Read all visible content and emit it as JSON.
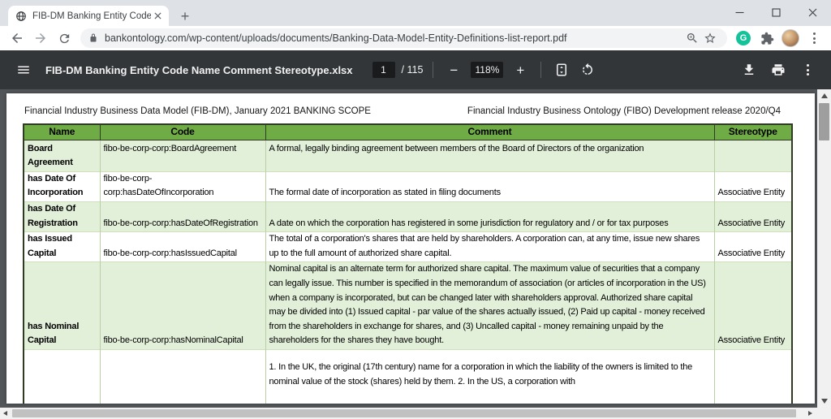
{
  "browser": {
    "tab_title": "FIB-DM Banking Entity Code Nam",
    "new_tab_glyph": "+",
    "url": "bankontology.com/wp-content/uploads/documents/Banking-Data-Model-Entity-Definitions-list-report.pdf",
    "grammarly_letter": "G"
  },
  "pdf_toolbar": {
    "filename": "FIB-DM Banking Entity Code Name Comment Stereotype.xlsx",
    "page_current": "1",
    "page_total_label": "/ 115",
    "zoom_out_glyph": "−",
    "zoom_level": "118%",
    "zoom_in_glyph": "+"
  },
  "document": {
    "header_left": "Financial Industry Business Data Model (FIB-DM), January 2021 BANKING SCOPE",
    "header_right": "Financial Industry Business Ontology (FIBO) Development release 2020/Q4",
    "table": {
      "columns": [
        "Name",
        "Code",
        "Comment",
        "Stereotype"
      ],
      "rows": [
        {
          "name": "Board Agreement",
          "code": "fibo-be-corp-corp:BoardAgreement",
          "comment": "A formal, legally binding agreement between members of the Board of Directors of the organization",
          "stereotype": ""
        },
        {
          "name": "has Date Of Incorporation",
          "code": "fibo-be-corp-corp:hasDateOfIncorporation",
          "comment": "The formal date of incorporation as stated in filing documents",
          "stereotype": "Associative Entity"
        },
        {
          "name": "has Date Of Registration",
          "code": "fibo-be-corp-corp:hasDateOfRegistration",
          "comment": "A date on which the corporation has registered in some jurisdiction for regulatory and / or for tax purposes",
          "stereotype": "Associative Entity"
        },
        {
          "name": "has Issued Capital",
          "code": "fibo-be-corp-corp:hasIssuedCapital",
          "comment": "The total of a corporation's shares that are held by shareholders. A corporation can, at any time, issue new shares up to the full amount of authorized share capital.",
          "stereotype": "Associative Entity"
        },
        {
          "name": "has Nominal Capital",
          "code": "fibo-be-corp-corp:hasNominalCapital",
          "comment": "Nominal capital is an alternate term for authorized share capital. The maximum value of securities that a company can legally issue. This number is specified in the memorandum of association (or articles of incorporation in the US) when a company is incorporated, but can be changed later with shareholders approval.  Authorized share capital may be divided into (1) Issued capital - par value of the shares actually issued, (2) Paid up capital - money received from the shareholders in exchange for shares, and (3) Uncalled capital - money remaining unpaid by the shareholders for the shares they have bought.",
          "stereotype": "Associative Entity"
        },
        {
          "name": "",
          "code": "",
          "comment": "1. In the UK, the original (17th century) name for a corporation in which the liability of the owners is limited to the nominal value of the stock (shares) held by them. 2. In the US, a corporation with",
          "stereotype": ""
        }
      ]
    }
  },
  "colors": {
    "table_header_green": "#6FAC46",
    "table_row_light_green": "#E2EFD9",
    "pdf_toolbar_bg": "#323639",
    "viewer_bg": "#525659",
    "tab_strip_bg": "#DEE1E6",
    "grammarly_green": "#15C39A"
  }
}
